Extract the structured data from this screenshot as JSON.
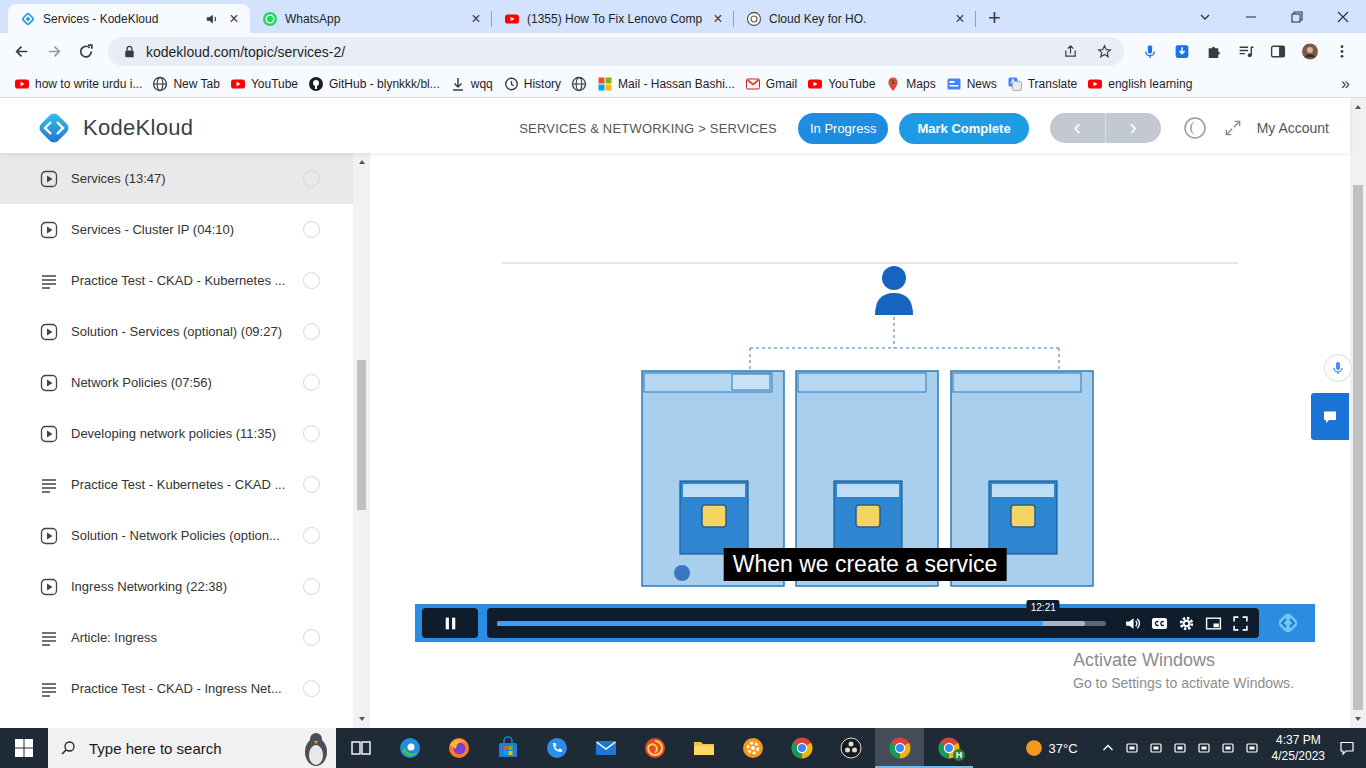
{
  "browser": {
    "tabs": [
      {
        "title": "Services - KodeKloud",
        "kind": "kodekloud",
        "selected": true,
        "audio": true
      },
      {
        "title": "WhatsApp",
        "kind": "whatsapp",
        "selected": false,
        "audio": false
      },
      {
        "title": "(1355) How To Fix Lenovo Comp",
        "kind": "youtube",
        "selected": false,
        "audio": false
      },
      {
        "title": "Cloud Key for HO.",
        "kind": "chatgpt",
        "selected": false,
        "audio": false
      }
    ],
    "tab_close": "×",
    "new_tab": "+",
    "url": "kodekloud.com/topic/services-2/",
    "bookmarks": [
      {
        "label": "how to write urdu i...",
        "kind": "youtube"
      },
      {
        "label": "New Tab",
        "kind": "globe"
      },
      {
        "label": "YouTube",
        "kind": "youtube"
      },
      {
        "label": "GitHub - blynkkk/bl...",
        "kind": "github"
      },
      {
        "label": "wqq",
        "kind": "download"
      },
      {
        "label": "History",
        "kind": "history"
      },
      {
        "label": "",
        "kind": "globe"
      },
      {
        "label": "Mail - Hassan Bashi...",
        "kind": "microsoft"
      },
      {
        "label": "Gmail",
        "kind": "gmail"
      },
      {
        "label": "YouTube",
        "kind": "youtube"
      },
      {
        "label": "Maps",
        "kind": "maps"
      },
      {
        "label": "News",
        "kind": "news"
      },
      {
        "label": "Translate",
        "kind": "translate"
      },
      {
        "label": "english learning",
        "kind": "youtube"
      }
    ],
    "bookmarks_more": "»"
  },
  "header": {
    "logo": "KodeKloud",
    "breadcrumb": "SERVICES & NETWORKING > SERVICES",
    "status": "In Progress",
    "complete_button": "Mark Complete",
    "prev": "‹",
    "next": "›",
    "account": "My Account"
  },
  "sidebar": {
    "items": [
      {
        "label": "Services (13:47)",
        "kind": "video",
        "selected": true,
        "completed": false
      },
      {
        "label": "Services - Cluster IP (04:10)",
        "kind": "video",
        "selected": false,
        "completed": false
      },
      {
        "label": "Practice Test - CKAD - Kubernetes ...",
        "kind": "doc",
        "selected": false,
        "completed": false
      },
      {
        "label": "Solution - Services (optional) (09:27)",
        "kind": "video",
        "selected": false,
        "completed": false
      },
      {
        "label": "Network Policies (07:56)",
        "kind": "video",
        "selected": false,
        "completed": false
      },
      {
        "label": "Developing network policies (11:35)",
        "kind": "video",
        "selected": false,
        "completed": false
      },
      {
        "label": "Practice Test - Kubernetes - CKAD ...",
        "kind": "doc",
        "selected": false,
        "completed": false
      },
      {
        "label": "Solution - Network Policies (option...",
        "kind": "video",
        "selected": false,
        "completed": false
      },
      {
        "label": "Ingress Networking (22:38)",
        "kind": "video",
        "selected": false,
        "completed": false
      },
      {
        "label": "Article: Ingress",
        "kind": "doc",
        "selected": false,
        "completed": false
      },
      {
        "label": "Practice Test - CKAD - Ingress Net...",
        "kind": "doc",
        "selected": false,
        "completed": false
      }
    ]
  },
  "player": {
    "caption": "When we create a service",
    "time": "12:21",
    "playing": true,
    "captions": true,
    "level": 0.897,
    "buffered": 0.966
  },
  "watermark": {
    "title": "Activate Windows",
    "subtitle": "Go to Settings to activate Windows."
  },
  "taskbar": {
    "search_placeholder": "Type here to search",
    "apps": [
      {
        "kind": "taskview",
        "open": false,
        "active": false,
        "badge": ""
      },
      {
        "kind": "edge",
        "open": false,
        "active": false,
        "badge": ""
      },
      {
        "kind": "firefox",
        "open": false,
        "active": false,
        "badge": ""
      },
      {
        "kind": "store",
        "open": false,
        "active": false,
        "badge": ""
      },
      {
        "kind": "phone",
        "open": false,
        "active": false,
        "badge": ""
      },
      {
        "kind": "mail",
        "open": false,
        "active": false,
        "badge": ""
      },
      {
        "kind": "swirl",
        "open": false,
        "active": false,
        "badge": ""
      },
      {
        "kind": "explorer",
        "open": false,
        "active": false,
        "badge": ""
      },
      {
        "kind": "settings",
        "open": false,
        "active": false,
        "badge": ""
      },
      {
        "kind": "chrome",
        "open": false,
        "active": false,
        "badge": ""
      },
      {
        "kind": "obs",
        "open": false,
        "active": false,
        "badge": ""
      },
      {
        "kind": "chrome",
        "open": true,
        "active": true,
        "badge": ""
      },
      {
        "kind": "chrome",
        "open": true,
        "active": false,
        "badge": "H"
      }
    ],
    "weather": "37°C",
    "time": "4:37 PM",
    "date": "4/25/2023"
  }
}
